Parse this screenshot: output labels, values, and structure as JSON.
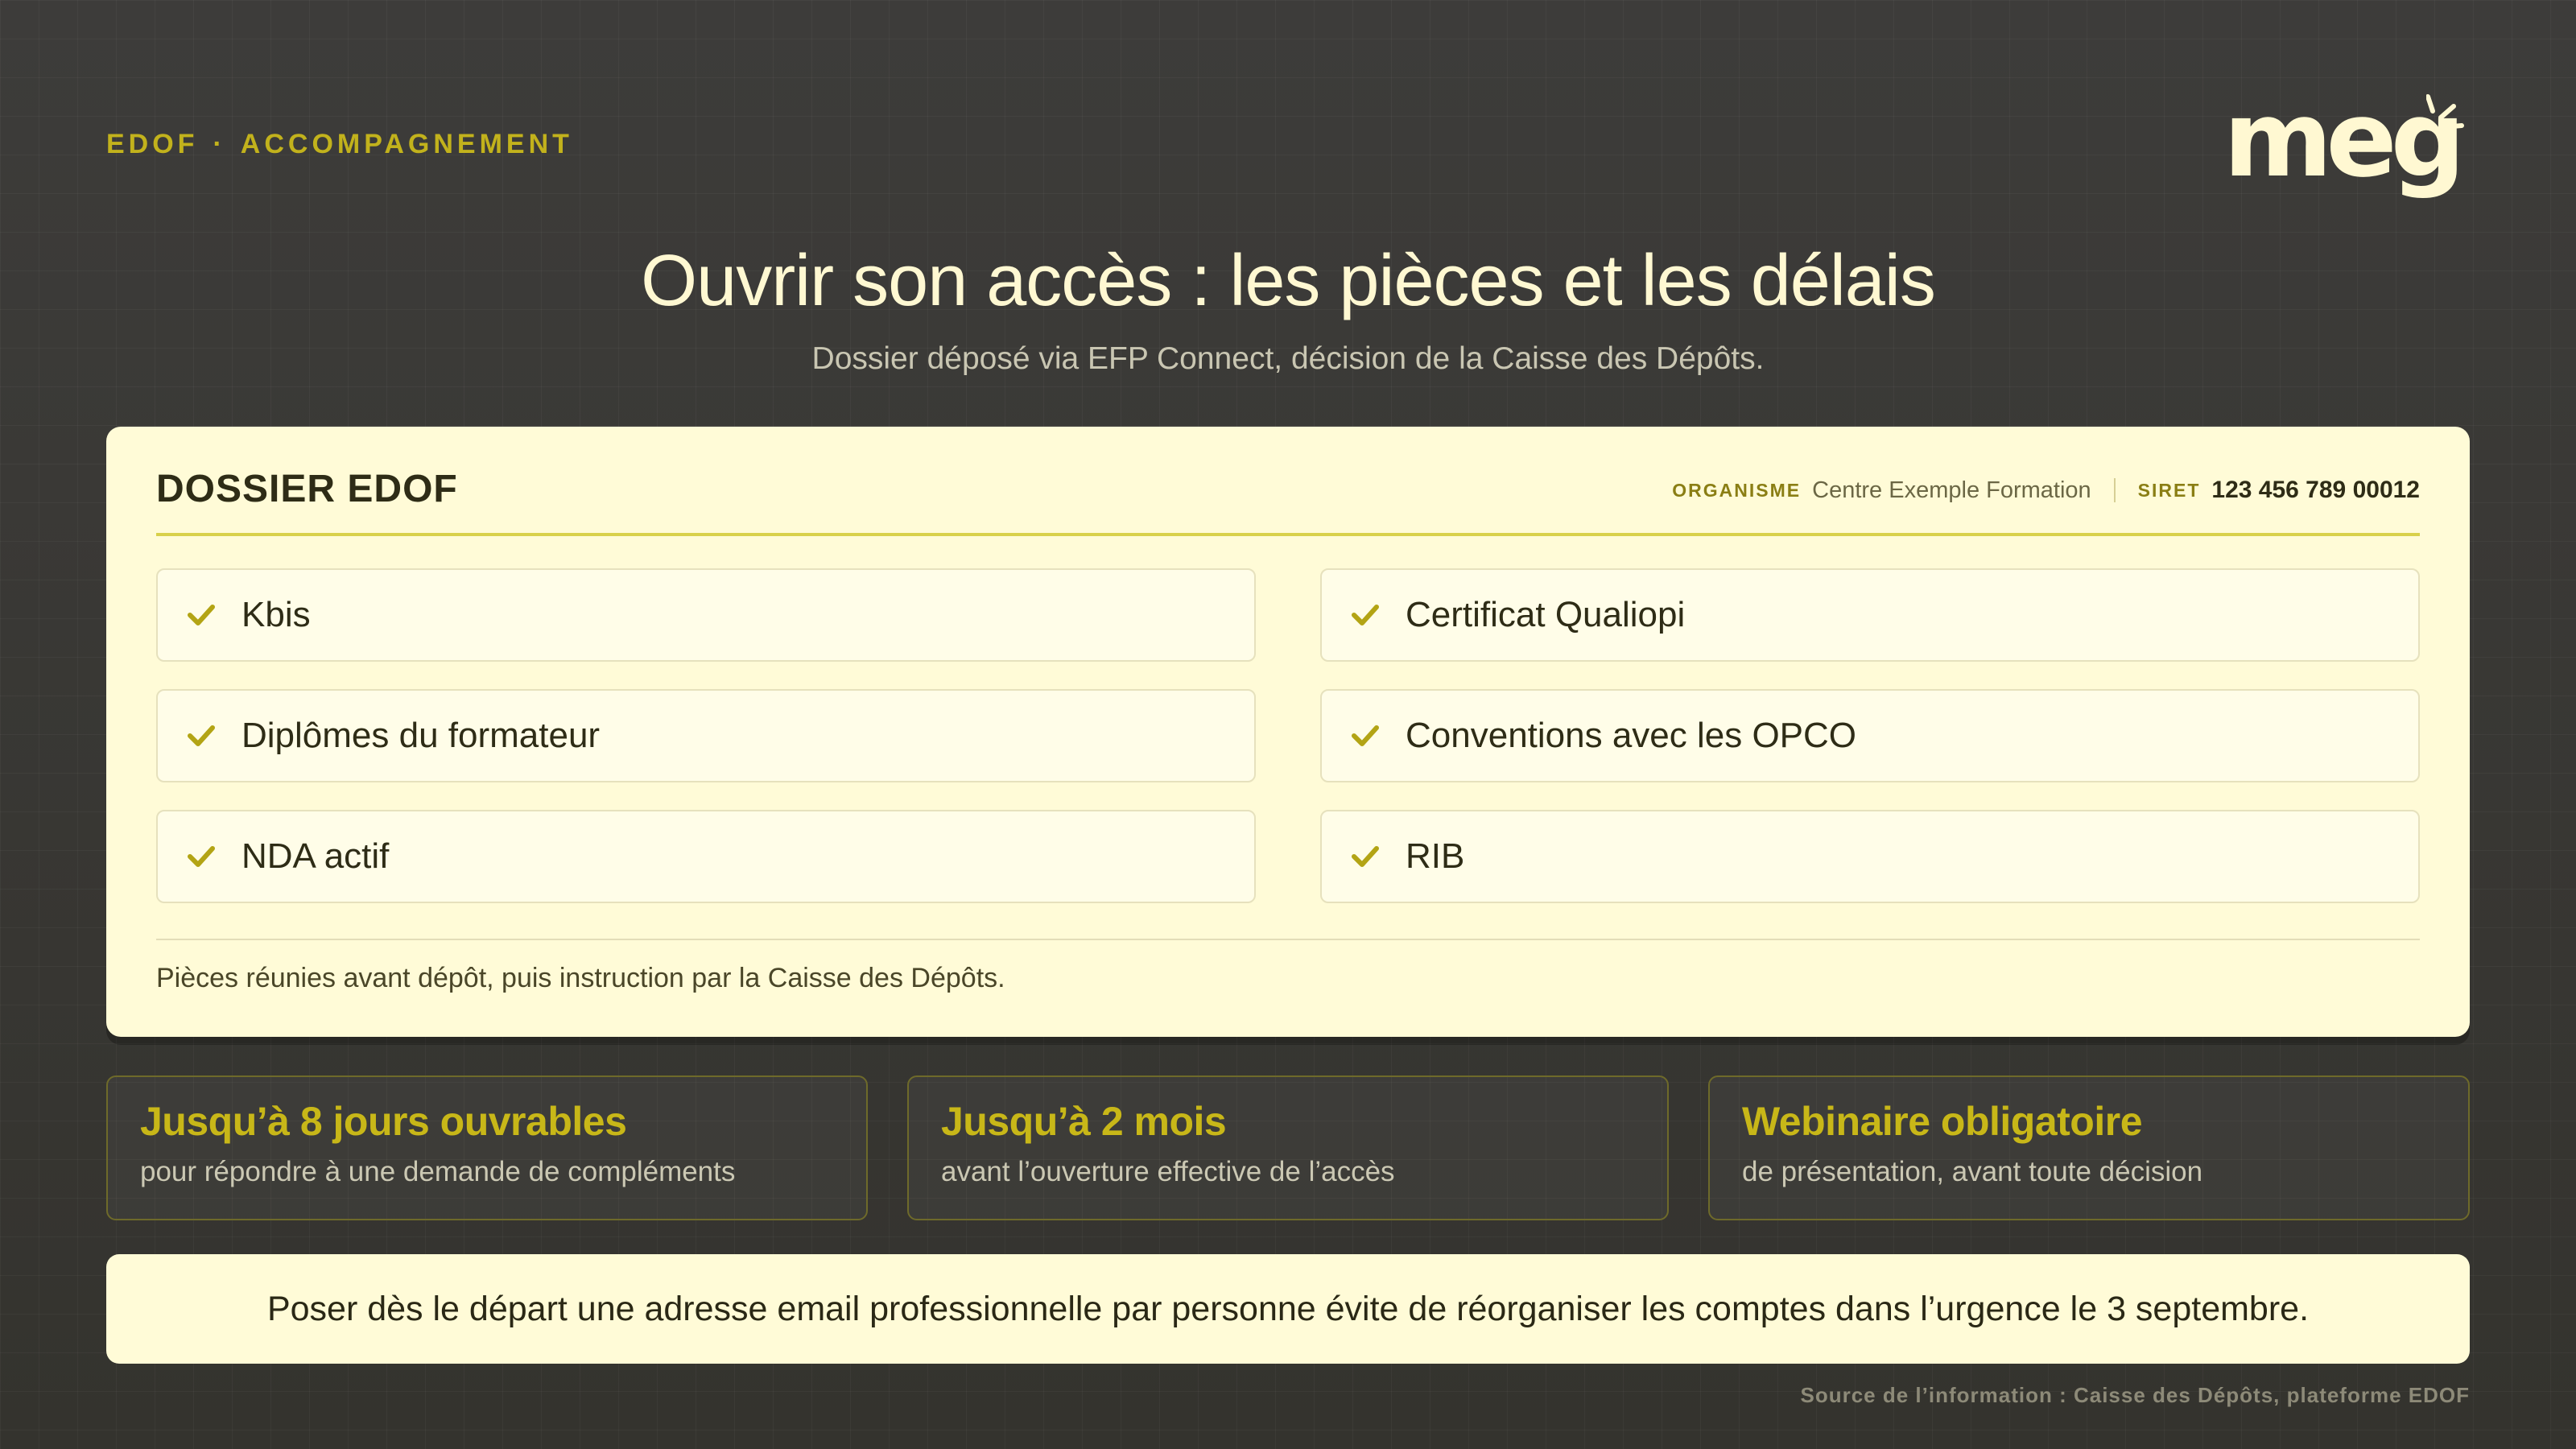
{
  "header": {
    "eyebrow_left": "EDOF",
    "eyebrow_separator": "·",
    "eyebrow_right": "ACCOMPAGNEMENT",
    "logo_text": "meg"
  },
  "title": "Ouvrir son accès : les pièces et les délais",
  "subtitle": "Dossier déposé via EFP Connect, décision de la Caisse des Dépôts.",
  "card": {
    "title": "DOSSIER EDOF",
    "organisme_label": "ORGANISME",
    "organisme_value": "Centre Exemple Formation",
    "siret_label": "SIRET",
    "siret_value": "123 456 789 00012",
    "items": [
      {
        "label": "Kbis",
        "icon": "check-icon"
      },
      {
        "label": "Certificat Qualiopi",
        "icon": "check-icon"
      },
      {
        "label": "Diplômes du formateur",
        "icon": "check-icon"
      },
      {
        "label": "Conventions avec les OPCO",
        "icon": "check-icon"
      },
      {
        "label": "NDA actif",
        "icon": "check-icon"
      },
      {
        "label": "RIB",
        "icon": "check-icon"
      }
    ],
    "note": "Pièces réunies avant dépôt, puis instruction par la Caisse des Dépôts."
  },
  "stats": [
    {
      "headline": "Jusqu’à 8 jours ouvrables",
      "detail": "pour répondre à une demande de compléments"
    },
    {
      "headline": "Jusqu’à 2 mois",
      "detail": "avant l’ouverture effective de l’accès"
    },
    {
      "headline": "Webinaire obligatoire",
      "detail": "de présentation, avant toute décision"
    }
  ],
  "tip": "Poser dès le départ une adresse email professionnelle par personne évite de réorganiser les comptes dans l’urgence le 3 septembre.",
  "source": "Source de l’information : Caisse des Dépôts, plateforme EDOF",
  "colors": {
    "background": "#3a3937",
    "accent": "#c2b21c",
    "card": "#fffbd7",
    "text_dark": "#2e2c16"
  }
}
